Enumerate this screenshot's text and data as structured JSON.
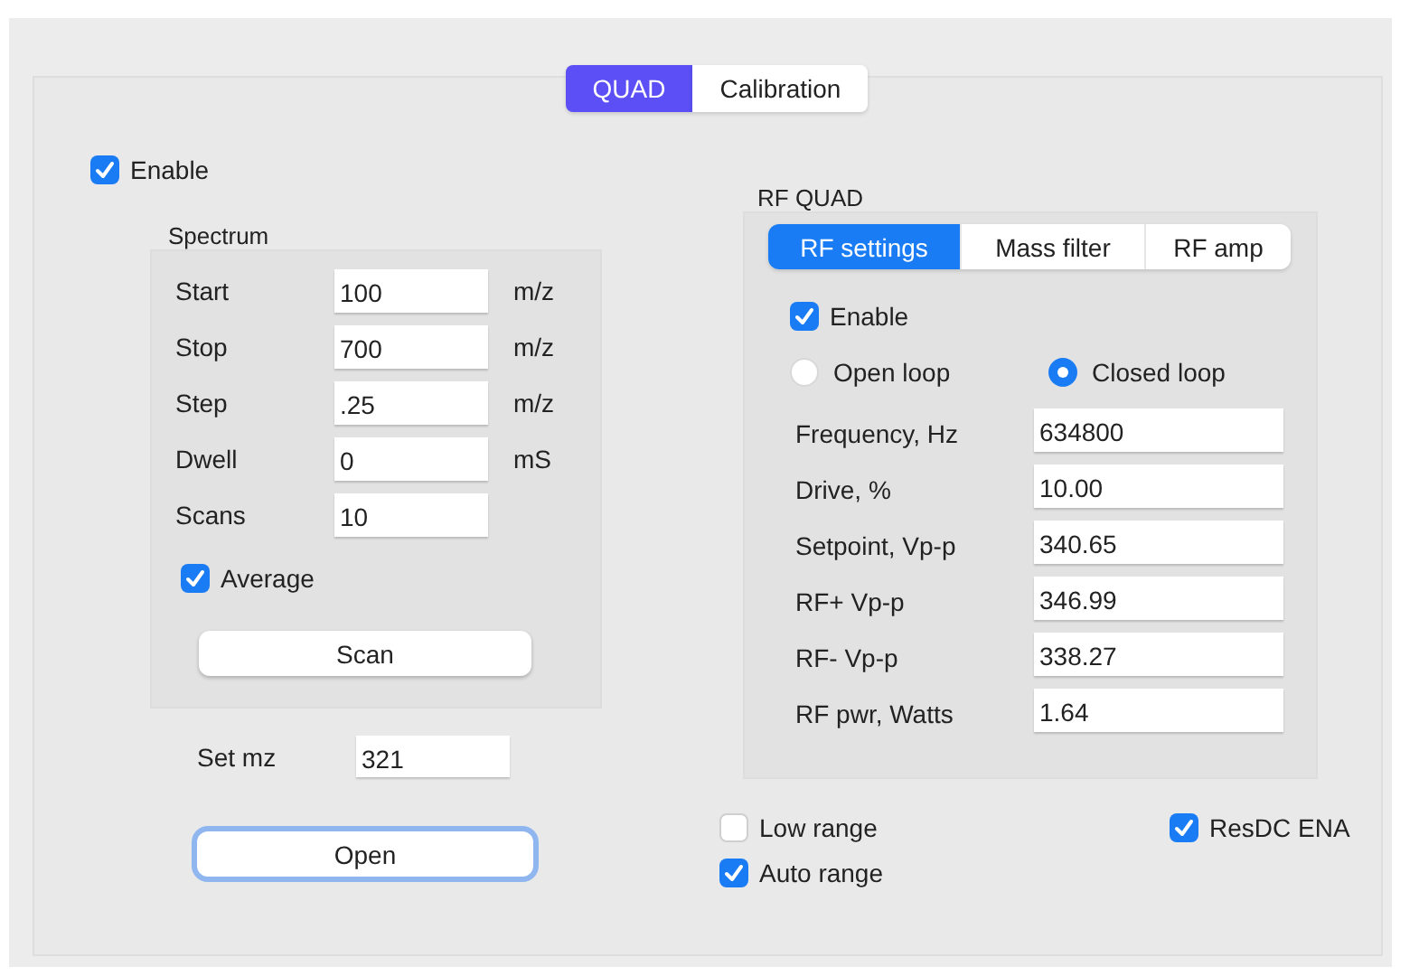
{
  "tabs": [
    {
      "label": "QUAD",
      "selected": true
    },
    {
      "label": "Calibration",
      "selected": false
    }
  ],
  "enable": {
    "label": "Enable",
    "checked": true
  },
  "spectrum": {
    "title": "Spectrum",
    "rows": [
      {
        "label": "Start",
        "value": "100",
        "unit": "m/z"
      },
      {
        "label": "Stop",
        "value": "700",
        "unit": "m/z"
      },
      {
        "label": "Step",
        "value": ".25",
        "unit": "m/z"
      },
      {
        "label": "Dwell",
        "value": "0",
        "unit": "mS"
      },
      {
        "label": "Scans",
        "value": "10"
      }
    ],
    "average": {
      "label": "Average",
      "checked": true
    },
    "scan_button": "Scan"
  },
  "set_mz": {
    "label": "Set mz",
    "value": "321"
  },
  "open_button": {
    "label": "Open",
    "focused": true
  },
  "rf_quad": {
    "title": "RF QUAD",
    "tabs": [
      {
        "label": "RF settings",
        "selected": true
      },
      {
        "label": "Mass filter",
        "selected": false
      },
      {
        "label": "RF amp",
        "selected": false
      }
    ],
    "enable": {
      "label": "Enable",
      "checked": true
    },
    "loop": [
      {
        "label": "Open loop",
        "selected": false
      },
      {
        "label": "Closed loop",
        "selected": true
      }
    ],
    "fields": [
      {
        "label": "Frequency, Hz",
        "value": "634800"
      },
      {
        "label": "Drive, %",
        "value": "10.00"
      },
      {
        "label": "Setpoint, Vp-p",
        "value": "340.65"
      },
      {
        "label": "RF+ Vp-p",
        "value": "346.99"
      },
      {
        "label": "RF- Vp-p",
        "value": "338.27"
      },
      {
        "label": "RF pwr, Watts",
        "value": "1.64"
      }
    ]
  },
  "options": [
    {
      "label": "Low range",
      "checked": false
    },
    {
      "label": "Auto range",
      "checked": true
    },
    {
      "label": "ResDC ENA",
      "checked": true
    }
  ]
}
